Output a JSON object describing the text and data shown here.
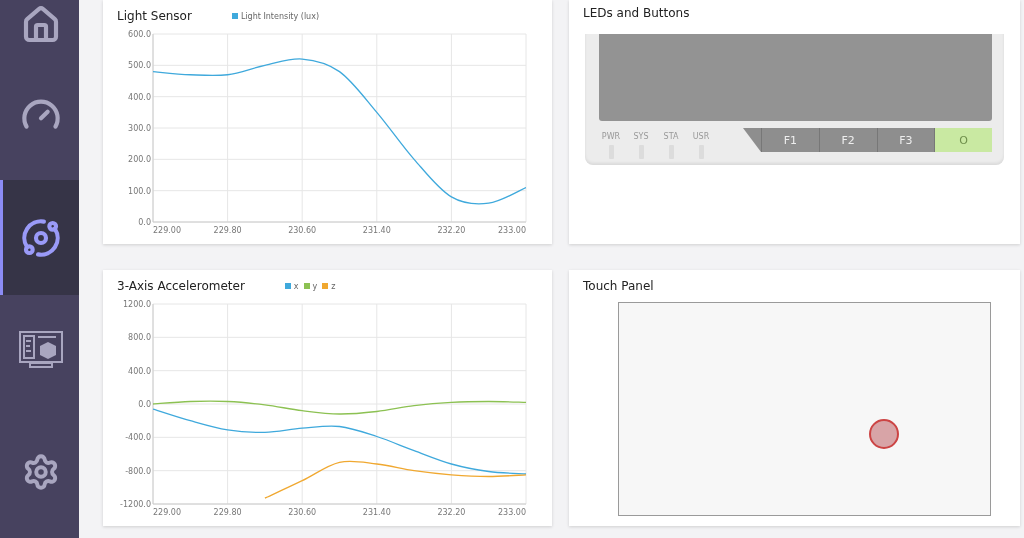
{
  "sidebar": {
    "items": [
      {
        "kind": "home",
        "selected": false
      },
      {
        "kind": "gauge",
        "selected": false
      },
      {
        "kind": "orbit",
        "selected": true
      },
      {
        "kind": "app",
        "selected": false
      },
      {
        "kind": "settings",
        "selected": false
      }
    ]
  },
  "light_sensor": {
    "title": "Light Sensor",
    "chart_data": {
      "type": "line",
      "grid": true,
      "x": [
        229.0,
        229.4,
        229.8,
        230.2,
        230.6,
        231.0,
        231.4,
        231.8,
        232.2,
        232.6,
        233.0
      ],
      "series": [
        {
          "name": "Light Intensity (lux)",
          "color": "#3fa9dc",
          "values": [
            480,
            470,
            470,
            500,
            520,
            480,
            350,
            200,
            80,
            60,
            110
          ]
        }
      ],
      "xlim": [
        229.0,
        233.0
      ],
      "ylim": [
        0,
        600
      ],
      "xticks": [
        {
          "value": 229.0,
          "label": "229.00"
        },
        {
          "value": 229.8,
          "label": "229.80"
        },
        {
          "value": 230.6,
          "label": "230.60"
        },
        {
          "value": 231.4,
          "label": "231.40"
        },
        {
          "value": 232.2,
          "label": "232.20"
        },
        {
          "value": 233.0,
          "label": "233.00"
        }
      ],
      "yticks": [
        {
          "value": 0,
          "label": "0.0"
        },
        {
          "value": 100,
          "label": "100.0"
        },
        {
          "value": 200,
          "label": "200.0"
        },
        {
          "value": 300,
          "label": "300.0"
        },
        {
          "value": 400,
          "label": "400.0"
        },
        {
          "value": 500,
          "label": "500.0"
        },
        {
          "value": 600,
          "label": "600.0"
        }
      ]
    }
  },
  "leds_and_buttons": {
    "title": "LEDs and Buttons",
    "leds": [
      {
        "label": "PWR",
        "on": false
      },
      {
        "label": "SYS",
        "on": false
      },
      {
        "label": "STA",
        "on": false
      },
      {
        "label": "USR",
        "on": false
      }
    ],
    "buttons": [
      {
        "label": "F1",
        "on": false
      },
      {
        "label": "F2",
        "on": false
      },
      {
        "label": "F3",
        "on": false
      },
      {
        "label": "O",
        "on": true
      }
    ]
  },
  "accelerometer": {
    "title": "3-Axis Accelerometer",
    "chart_data": {
      "type": "line",
      "grid": true,
      "x": [
        229.0,
        229.4,
        229.8,
        230.2,
        230.6,
        231.0,
        231.4,
        231.8,
        232.2,
        232.6,
        233.0
      ],
      "series": [
        {
          "name": "x",
          "color": "#3fa9dc",
          "values": [
            -60,
            -200,
            -310,
            -340,
            -290,
            -270,
            -390,
            -560,
            -720,
            -810,
            -840
          ]
        },
        {
          "name": "y",
          "color": "#8cc152",
          "values": [
            0,
            30,
            30,
            -10,
            -80,
            -120,
            -90,
            -20,
            20,
            30,
            20
          ]
        },
        {
          "name": "z",
          "color": "#f0a830",
          "values": [
            null,
            null,
            null,
            -1130,
            -920,
            -700,
            -720,
            -800,
            -850,
            -870,
            -850
          ]
        }
      ],
      "xlim": [
        229.0,
        233.0
      ],
      "ylim": [
        -1200,
        1200
      ],
      "xticks": [
        {
          "value": 229.0,
          "label": "229.00"
        },
        {
          "value": 229.8,
          "label": "229.80"
        },
        {
          "value": 230.6,
          "label": "230.60"
        },
        {
          "value": 231.4,
          "label": "231.40"
        },
        {
          "value": 232.2,
          "label": "232.20"
        },
        {
          "value": 233.0,
          "label": "233.00"
        }
      ],
      "yticks": [
        {
          "value": -1200,
          "label": "-1200.0"
        },
        {
          "value": -800,
          "label": "-800.0"
        },
        {
          "value": -400,
          "label": "-400.0"
        },
        {
          "value": 0,
          "label": "0.0"
        },
        {
          "value": 400,
          "label": "400.0"
        },
        {
          "value": 800,
          "label": "800.0"
        },
        {
          "value": 1200,
          "label": "1200.0"
        }
      ]
    }
  },
  "touch_panel": {
    "title": "Touch Panel"
  }
}
